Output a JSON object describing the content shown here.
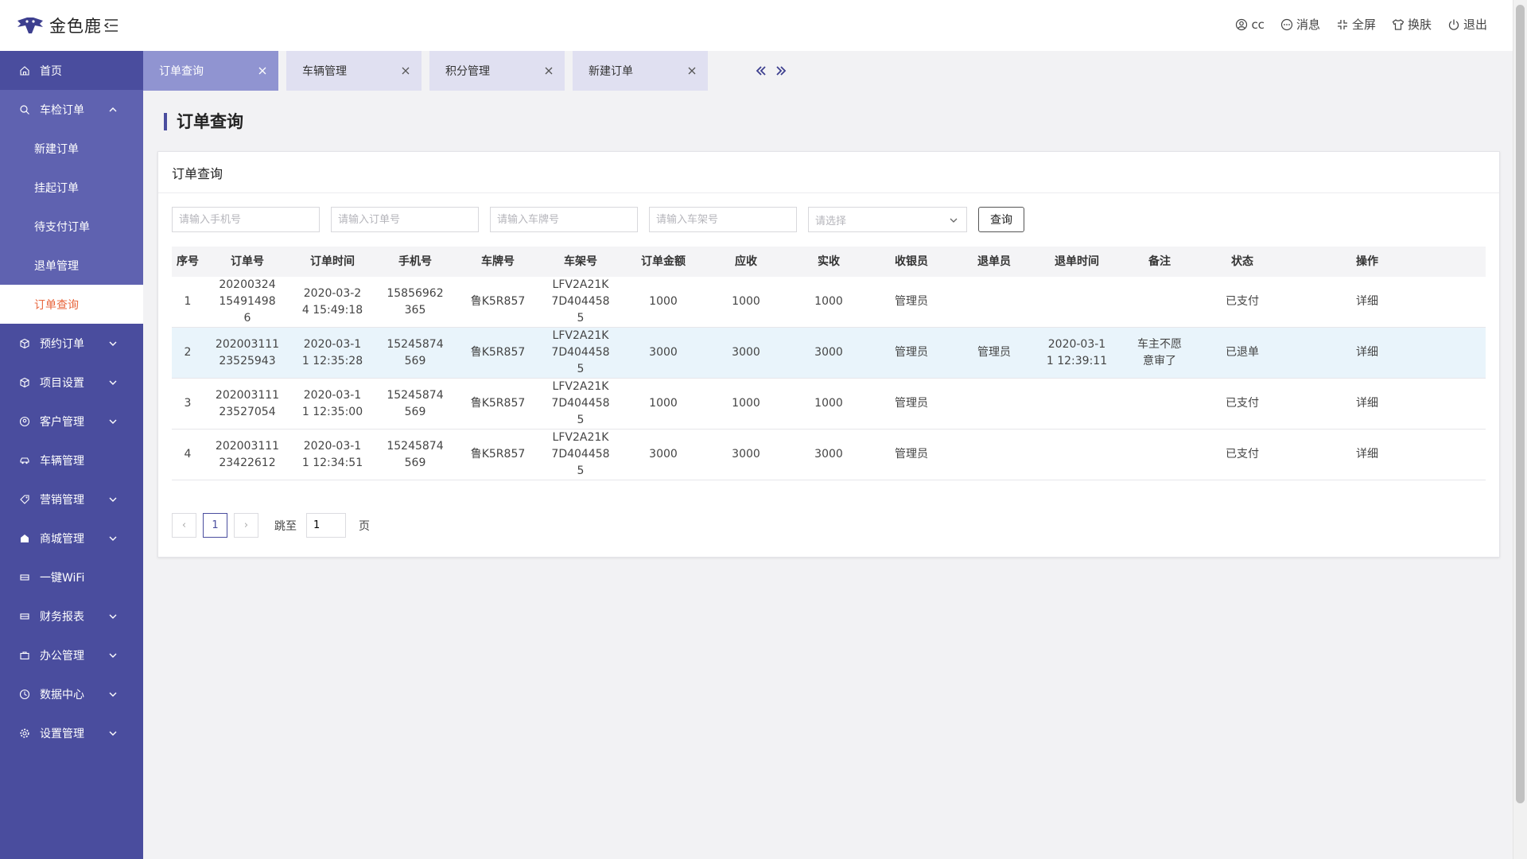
{
  "app": {
    "name": "金色鹿"
  },
  "topnav": [
    {
      "label": "cc",
      "icon": "user-icon"
    },
    {
      "label": "消息",
      "icon": "message-icon"
    },
    {
      "label": "全屏",
      "icon": "fullscreen-icon"
    },
    {
      "label": "换肤",
      "icon": "shirt-icon"
    },
    {
      "label": "退出",
      "icon": "power-icon"
    }
  ],
  "sidebar": {
    "items": [
      {
        "label": "首页",
        "icon": "home-icon"
      },
      {
        "label": "车检订单",
        "icon": "search-icon"
      },
      {
        "label": "预约订单",
        "icon": "cube-icon"
      },
      {
        "label": "项目设置",
        "icon": "cube-icon"
      },
      {
        "label": "客户管理",
        "icon": "customer-icon"
      },
      {
        "label": "车辆管理",
        "icon": "car-icon"
      },
      {
        "label": "营销管理",
        "icon": "tag-icon"
      },
      {
        "label": "商城管理",
        "icon": "shop-icon"
      },
      {
        "label": "一键WiFi",
        "icon": "wifi-icon"
      },
      {
        "label": "财务报表",
        "icon": "report-icon"
      },
      {
        "label": "办公管理",
        "icon": "briefcase-icon"
      },
      {
        "label": "数据中心",
        "icon": "data-icon"
      },
      {
        "label": "设置管理",
        "icon": "settings-icon"
      }
    ],
    "sub": [
      "新建订单",
      "挂起订单",
      "待支付订单",
      "退单管理",
      "订单查询"
    ]
  },
  "tabs": [
    "订单查询",
    "车辆管理",
    "积分管理",
    "新建订单"
  ],
  "page": {
    "title": "订单查询",
    "card_title": "订单查询"
  },
  "filters": {
    "phone_placeholder": "请输入手机号",
    "order_placeholder": "请输入订单号",
    "plate_placeholder": "请输入车牌号",
    "vin_placeholder": "请输入车架号",
    "select_placeholder": "请选择",
    "query_label": "查询"
  },
  "table": {
    "headers": [
      "序号",
      "订单号",
      "订单时间",
      "手机号",
      "车牌号",
      "车架号",
      "订单金额",
      "应收",
      "实收",
      "收银员",
      "退单员",
      "退单时间",
      "备注",
      "状态",
      "操作"
    ],
    "rows": [
      [
        "1",
        "202003241549 14986",
        "2020-03-24 15:49:18",
        "15856962365",
        "鲁K5R857",
        "LFV2A21K7D4044585",
        "1000",
        "1000",
        "1000",
        "管理员",
        "",
        "",
        "",
        "已支付",
        "详细"
      ],
      [
        "2",
        "20200311123525943",
        "2020-03-11 12:35:28",
        "15245874569",
        "鲁K5R857",
        "LFV2A21K7D4044585",
        "3000",
        "3000",
        "3000",
        "管理员",
        "管理员",
        "2020-03-11 12:39:11",
        "车主不愿意审了",
        "已退单",
        "详细"
      ],
      [
        "3",
        "20200311123527054",
        "2020-03-11 12:35:00",
        "15245874569",
        "鲁K5R857",
        "LFV2A21K7D4044585",
        "1000",
        "1000",
        "1000",
        "管理员",
        "",
        "",
        "",
        "已支付",
        "详细"
      ],
      [
        "4",
        "20200311123422612",
        "2020-03-11 12:34:51",
        "15245874569",
        "鲁K5R857",
        "LFV2A21K7D4044585",
        "3000",
        "3000",
        "3000",
        "管理员",
        "",
        "",
        "",
        "已支付",
        "详细"
      ]
    ],
    "display_rows": [
      [
        "1",
        "20200324\n15491498\n6",
        "2020-03-2\n4 15:49:18",
        "15856962\n365",
        "鲁K5R857",
        "LFV2A21K\n7D404458\n5",
        "1000",
        "1000",
        "1000",
        "管理员",
        "",
        "",
        "",
        "已支付",
        "详细"
      ],
      [
        "2",
        "202003111\n23525943",
        "2020-03-1\n1 12:35:28",
        "15245874\n569",
        "鲁K5R857",
        "LFV2A21K\n7D404458\n5",
        "3000",
        "3000",
        "3000",
        "管理员",
        "管理员",
        "2020-03-1\n1 12:39:11",
        "车主不愿\n意审了",
        "已退单",
        "详细"
      ],
      [
        "3",
        "202003111\n23527054",
        "2020-03-1\n1 12:35:00",
        "15245874\n569",
        "鲁K5R857",
        "LFV2A21K\n7D404458\n5",
        "1000",
        "1000",
        "1000",
        "管理员",
        "",
        "",
        "",
        "已支付",
        "详细"
      ],
      [
        "4",
        "202003111\n23422612",
        "2020-03-1\n1 12:34:51",
        "15245874\n569",
        "鲁K5R857",
        "LFV2A21K\n7D404458\n5",
        "3000",
        "3000",
        "3000",
        "管理员",
        "",
        "",
        "",
        "已支付",
        "详细"
      ]
    ]
  },
  "pagination": {
    "prev": "‹",
    "current": "1",
    "next": "›",
    "jump_label": "跳至",
    "jump_value": "1",
    "unit": "页"
  },
  "colors": {
    "sidebar": "#4a4d9e",
    "sidebar_sub": "#5f62b0",
    "active_tab": "#9094d1",
    "inactive_tab": "#e0e0f1",
    "active_text": "#e8663d",
    "row_highlight": "#e9f4fb"
  }
}
